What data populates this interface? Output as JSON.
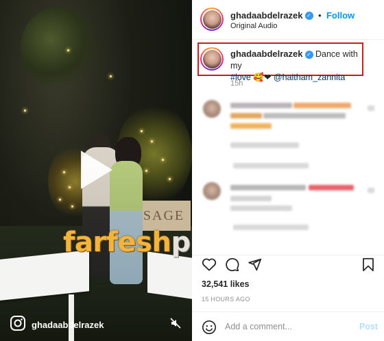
{
  "post": {
    "username": "ghadaabdelrazek",
    "follow_label": "Follow",
    "follow_sep": "•",
    "audio_label": "Original Audio",
    "caption_user": "ghadaabdelrazek",
    "caption_text_1": "Dance with my",
    "caption_text_2": "#love",
    "caption_emojis": "🥰❤",
    "caption_mention": "@haitham_zannita",
    "caption_time": "15h",
    "likes": "32,541 likes",
    "posted_ago": "15 HOURS AGO",
    "comment_placeholder": "Add a comment...",
    "post_label": "Post"
  },
  "video": {
    "overlay_username": "ghadaabdelrazek",
    "sign_text": "SAGE",
    "watermark_part1": "farfesh",
    "watermark_part2": "plus.com"
  },
  "colors": {
    "accent": "#0095f6",
    "highlight_border": "#d0191b",
    "muted_text": "#8e8e8e",
    "verified": "#3897f0"
  },
  "icons": [
    "heart-icon",
    "comment-icon",
    "share-icon",
    "bookmark-icon",
    "emoji-icon",
    "instagram-icon",
    "mute-icon",
    "verified-icon",
    "play-icon"
  ]
}
